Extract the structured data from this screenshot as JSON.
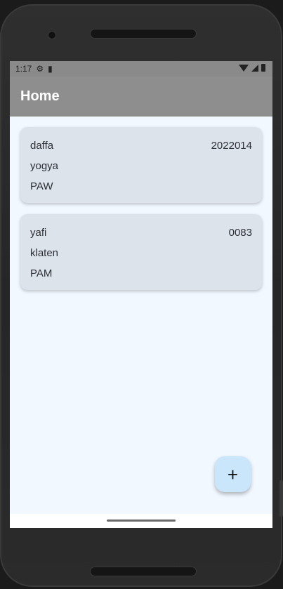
{
  "status_bar": {
    "time": "1:17",
    "icons": [
      "gear-icon",
      "sd-card-icon",
      "wifi-icon",
      "signal-icon",
      "battery-icon"
    ]
  },
  "app_bar": {
    "title": "Home"
  },
  "items": [
    {
      "name": "daffa",
      "nim": "2022014",
      "city": "yogya",
      "course": "PAW"
    },
    {
      "name": "yafi",
      "nim": "0083",
      "city": "klaten",
      "course": "PAM"
    }
  ],
  "fab": {
    "label": "+",
    "icon": "plus-icon"
  }
}
